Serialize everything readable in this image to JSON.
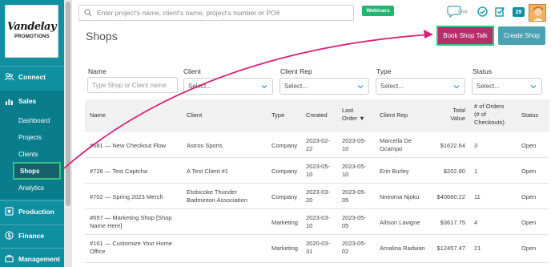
{
  "logo": {
    "name": "Vandelay",
    "sub": "PROMOTIONS"
  },
  "sidebar": {
    "sections": [
      {
        "label": "Connect",
        "icon": "people-icon"
      },
      {
        "label": "Sales",
        "icon": "bar-chart-icon"
      },
      {
        "label": "Production",
        "icon": "factory-icon"
      },
      {
        "label": "Finance",
        "icon": "dollar-icon"
      },
      {
        "label": "Management",
        "icon": "briefcase-icon"
      }
    ],
    "sales_items": [
      "Dashboard",
      "Projects",
      "Clients",
      "Shops",
      "Analytics"
    ],
    "active_item": "Shops"
  },
  "topbar": {
    "search_placeholder": "Enter project's name, client's name, project's number or PO#",
    "webinars_label": "Webinars",
    "chat_label": "Chat",
    "notifications_count": "29"
  },
  "header": {
    "title": "Shops",
    "book_label": "Book Shop Talk",
    "create_label": "Create Shop"
  },
  "filters": {
    "name_label": "Name",
    "name_placeholder": "Type Shop or Client name",
    "client_label": "Client",
    "client_value": "Select...",
    "rep_label": "Client Rep",
    "rep_value": "Select...",
    "type_label": "Type",
    "type_value": "Select...",
    "status_label": "Status",
    "status_value": "Select..."
  },
  "table": {
    "headers": {
      "name": "Name",
      "client": "Client",
      "type": "Type",
      "created": "Created",
      "last_order_1": "Last",
      "last_order_2": "Order ▼",
      "rep": "Client Rep",
      "total_1": "Total",
      "total_2": "Value",
      "orders_1": "# of Orders",
      "orders_2": "(# of",
      "orders_3": "Checkouts)",
      "status": "Status"
    },
    "rows": [
      {
        "name1": "#681 — New Checkout Flow",
        "name2": "",
        "client1": "Astros Sports",
        "client2": "",
        "type": "Company",
        "created1": "2023-02-",
        "created2": "22",
        "last1": "2023-05-",
        "last2": "10",
        "rep1": "Marcella De",
        "rep2": "Ocampo",
        "total": "$1622.64",
        "orders": "3",
        "status": "Open"
      },
      {
        "name1": "#726 — Test Captcha",
        "name2": "",
        "client1": "A Test Client #1",
        "client2": "",
        "type": "Company",
        "created1": "2023-05-",
        "created2": "10",
        "last1": "2023-05-",
        "last2": "10",
        "rep1": "Erin Burley",
        "rep2": "",
        "total": "$202.80",
        "orders": "1",
        "status": "Open"
      },
      {
        "name1": "#702 — Spring 2023 Merch",
        "name2": "",
        "client1": "Etobicoke Thunder",
        "client2": "Badminton Association",
        "type": "Company",
        "created1": "2023-03-",
        "created2": "20",
        "last1": "2023-05-",
        "last2": "05",
        "rep1": "Nneoma Njoku",
        "rep2": "",
        "total": "$40660.22",
        "orders": "11",
        "status": "Open"
      },
      {
        "name1": "#697 — Marketing Shop [Shop",
        "name2": "Name Here]",
        "client1": "",
        "client2": "",
        "type": "Marketing",
        "created1": "2023-03-",
        "created2": "10",
        "last1": "2023-05-",
        "last2": "05",
        "rep1": "Allison Lavigne",
        "rep2": "",
        "total": "$3617.75",
        "orders": "4",
        "status": "Open"
      },
      {
        "name1": "#161 — Customize Your Home",
        "name2": "Office",
        "client1": "",
        "client2": "",
        "type": "Marketing",
        "created1": "2020-03-",
        "created2": "31",
        "last1": "2023-05-",
        "last2": "02",
        "rep1": "Amalina Radwan",
        "rep2": "",
        "total": "$12457.47",
        "orders": "21",
        "status": "Open"
      }
    ]
  },
  "colors": {
    "sidebar": "#0f8fa0",
    "book_button": "#b62f6a",
    "create_button": "#4aa2b3",
    "highlight_border": "#35c47a",
    "annotation_arrow": "#d6247a"
  }
}
